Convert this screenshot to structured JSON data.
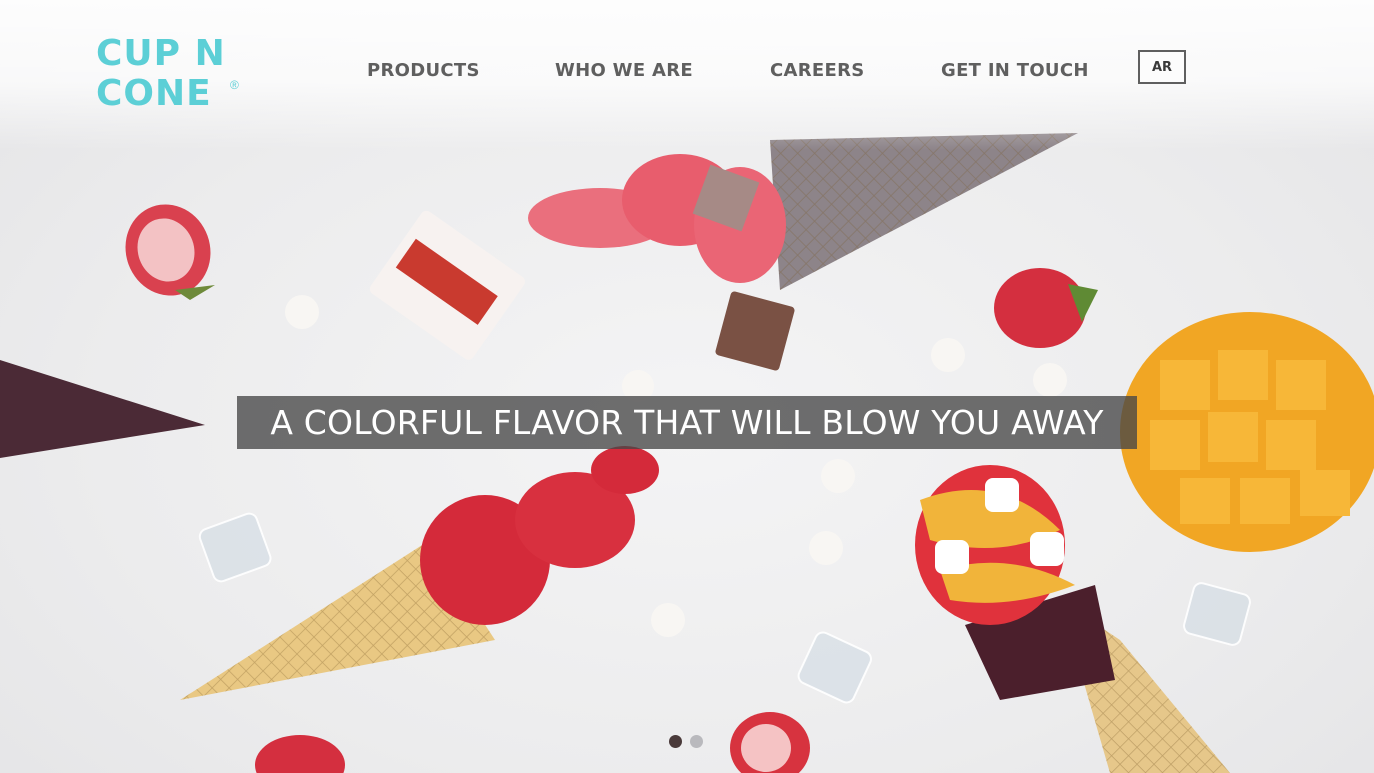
{
  "header": {
    "logo": {
      "line1": "CUP N",
      "line2": "CONE",
      "registered": "®",
      "color": "#5ccfd6"
    },
    "nav": [
      {
        "label": "PRODUCTS"
      },
      {
        "label": "WHO WE ARE"
      },
      {
        "label": "CAREERS"
      },
      {
        "label": "GET IN TOUCH"
      }
    ],
    "language_button": "AR"
  },
  "hero": {
    "image": "ice-cream-cones-flatlay",
    "tagline": "A COLORFUL FLAVOR THAT WILL BLOW YOU AWAY",
    "slides": {
      "count": 2,
      "active": 1
    }
  },
  "colors": {
    "nav_text": "#5f5f5f",
    "tagline_bg": "#464646",
    "dot_active": "#4a3a3a",
    "dot_inactive": "#b9b9bd"
  }
}
